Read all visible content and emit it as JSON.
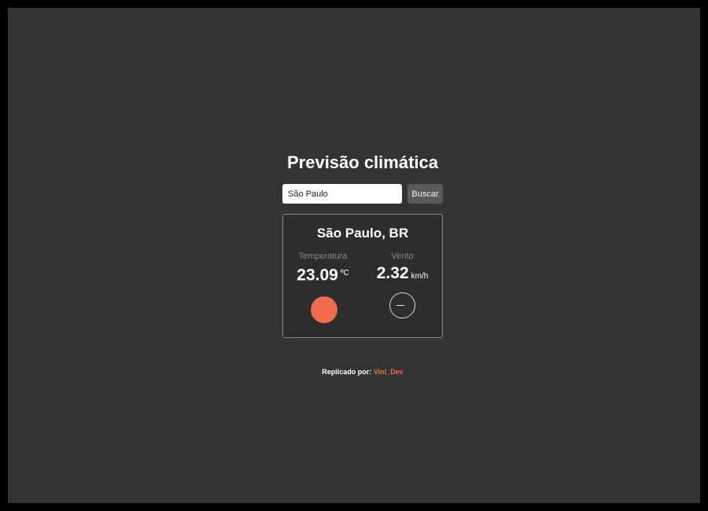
{
  "header": {
    "title": "Previsão climática"
  },
  "search": {
    "value": "São Paulo",
    "button_label": "Buscar"
  },
  "weather": {
    "location": "São Paulo, BR",
    "temperature": {
      "label": "Temperatura",
      "value": "23.09",
      "unit": "ºC",
      "indicator_color": "#f06b4f",
      "indicator_icon": "temperature-circle-icon"
    },
    "wind": {
      "label": "Vento",
      "value": "2.32",
      "unit": "km/h",
      "indicator_icon": "wind-direction-icon"
    }
  },
  "footer": {
    "prefix": "Replicado por:",
    "author": "Vini_Dev"
  },
  "colors": {
    "background": "#333333",
    "card": "#2d2d2d",
    "accent": "#f06b4f"
  }
}
